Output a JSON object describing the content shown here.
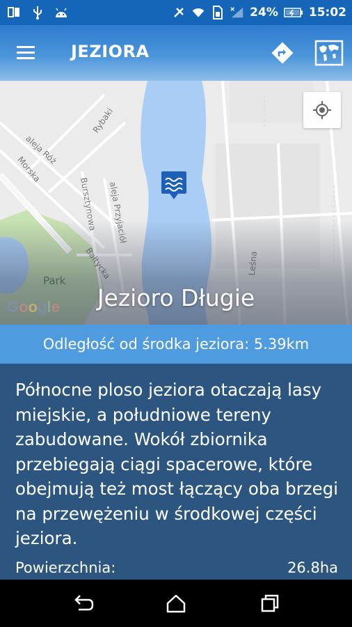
{
  "status_bar": {
    "battery": "24%",
    "time": "15:02"
  },
  "app_bar": {
    "title": "JEZIORA"
  },
  "map": {
    "streets": [
      "aleja Róż",
      "Morska",
      "Rybaki",
      "Bursztynowa",
      "aleja Przyjaciół",
      "Bałtycka",
      "Park",
      "Leśna"
    ],
    "lake_label": "Jezioro Długie",
    "provider": "Google"
  },
  "distance": {
    "text": "Odległość od środka jeziora: 5.39km"
  },
  "details": {
    "description": "Północne ploso jeziora otaczają lasy miejskie, a południowe tereny zabudowane. Wokół zbiornika przebiegają ciągi spacerowe, które obejmują też most łączący oba brzegi na przewężeniu w środkowej części jeziora.",
    "area_label": "Powierzchnia:",
    "area_value": "26.8ha"
  },
  "colors": {
    "status_bar": "#1565b8",
    "distance_bar": "#4f9be0",
    "content_bg": "#2c5680",
    "water": "#a9cdf5"
  }
}
